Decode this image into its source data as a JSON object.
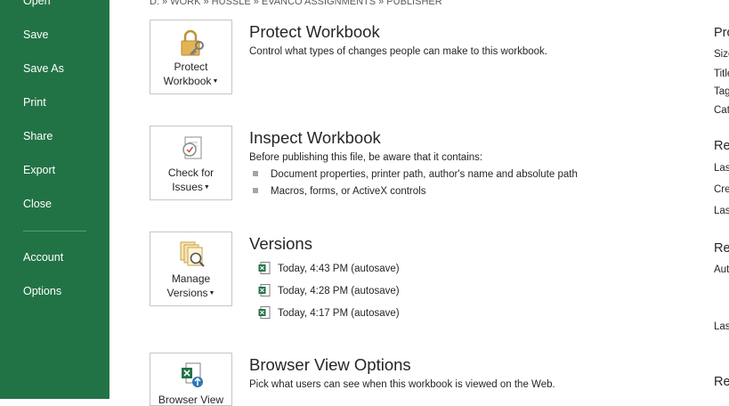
{
  "nav": {
    "items": [
      "Open",
      "Save",
      "Save As",
      "Print",
      "Share",
      "Export",
      "Close"
    ],
    "items2": [
      "Account",
      "Options"
    ]
  },
  "breadcrumb": "D: » WORK » HUSSLE » EVANCO ASSIGNMENTS » PUBLISHER",
  "protect": {
    "button_line1": "Protect",
    "button_line2": "Workbook",
    "title": "Protect Workbook",
    "description": "Control what types of changes people can make to this workbook.",
    "icon": "lock-key-icon"
  },
  "inspect": {
    "button_line1": "Check for",
    "button_line2": "Issues",
    "title": "Inspect Workbook",
    "description": "Before publishing this file, be aware that it contains:",
    "bullets": [
      "Document properties, printer path, author's name and absolute path",
      "Macros, forms, or ActiveX controls"
    ],
    "icon": "inspect-document-icon"
  },
  "versions": {
    "button_line1": "Manage",
    "button_line2": "Versions",
    "title": "Versions",
    "items": [
      "Today, 4:43 PM (autosave)",
      "Today, 4:28 PM (autosave)",
      "Today, 4:17 PM (autosave)"
    ],
    "icon": "manage-versions-icon"
  },
  "browser": {
    "button_line1": "Browser View",
    "title": "Browser View Options",
    "description": "Pick what users can see when this workbook is viewed on the Web.",
    "icon": "browser-view-icon"
  },
  "right": {
    "heads": [
      "Pro",
      "Re",
      "Re",
      "Re"
    ],
    "labels": [
      "Size",
      "Title",
      "Tag",
      "Cat",
      "Las",
      "Cre",
      "Las",
      "Aut",
      "Las"
    ]
  },
  "colors": {
    "nav_bg": "#217346",
    "excel_green": "#217346"
  }
}
